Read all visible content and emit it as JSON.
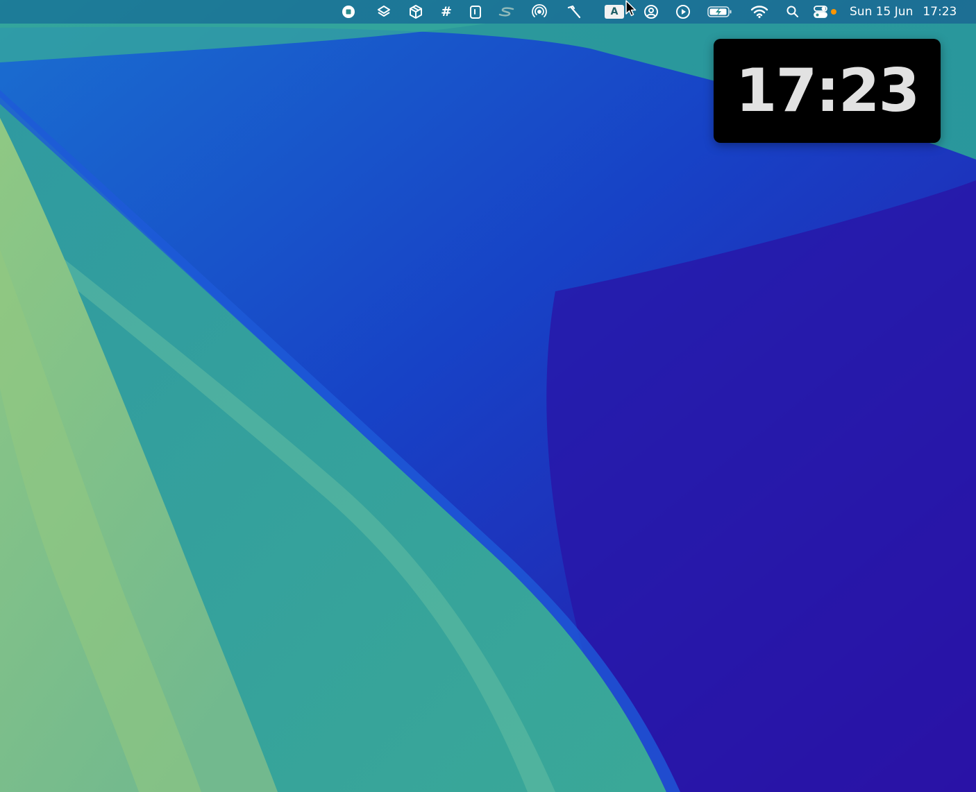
{
  "wallpaper": {
    "colors": {
      "light_green": "#8cc483",
      "teal": "#3aa69a",
      "blue": "#1046c8",
      "indigo": "#2a17a8"
    }
  },
  "menubar": {
    "status_icons": [
      "record-stop-icon",
      "layers-icon",
      "package-box-icon",
      "hash-icon",
      "clipboard-icon",
      "stage-s-icon",
      "airdrop-radar-icon",
      "hammer-icon",
      "input-source-icon",
      "user-circle-icon",
      "play-circle-icon",
      "battery-charging-icon",
      "wifi-icon",
      "spotlight-search-icon",
      "control-center-icon"
    ],
    "hash_symbol": "#",
    "input_source_label": "A",
    "date": "Sun 15 Jun",
    "time": "17:23",
    "indicator_color": "#ff9500"
  },
  "clock_widget": {
    "time": "17:23"
  }
}
